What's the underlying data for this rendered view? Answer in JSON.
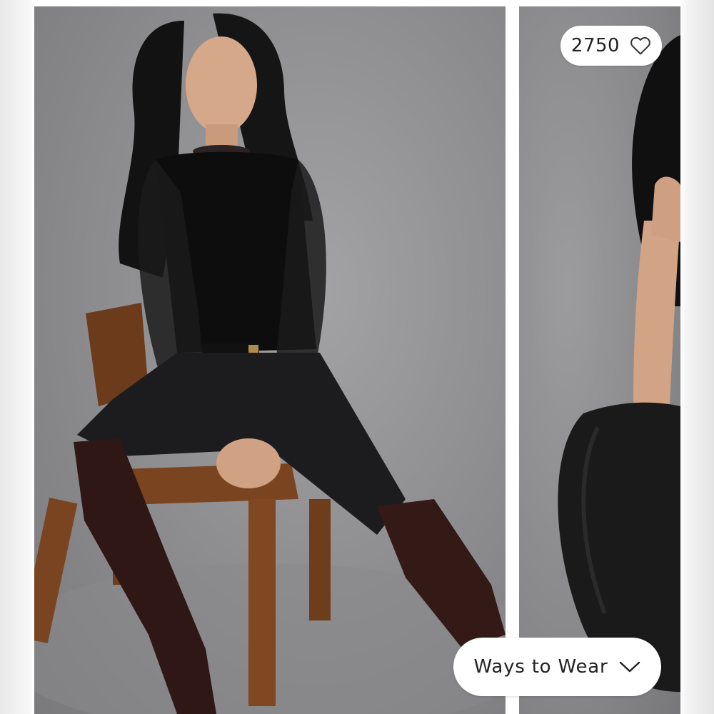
{
  "gallery": {
    "images": [
      {
        "alt": ""
      },
      {
        "alt": ""
      }
    ]
  },
  "likes": {
    "count": "2750",
    "icon": "heart-outline-icon"
  },
  "ways_to_wear": {
    "label": "Ways to Wear",
    "icon": "chevron-down-icon"
  },
  "colors": {
    "pill_background": "#ffffff",
    "text": "#222222",
    "backdrop": "#8c8c8e"
  }
}
